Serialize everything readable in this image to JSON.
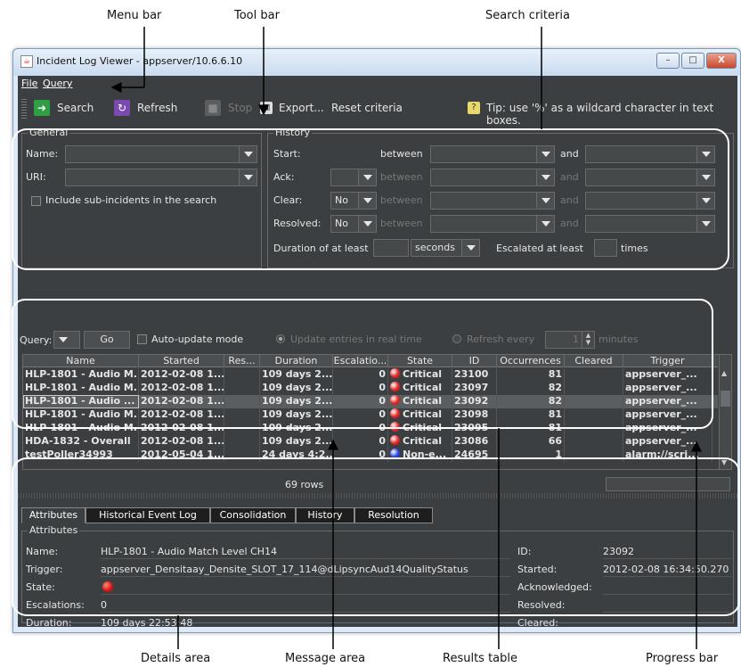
{
  "callouts": {
    "menu_bar": "Menu bar",
    "tool_bar": "Tool bar",
    "search_criteria": "Search criteria",
    "details_area": "Details area",
    "message_area": "Message area",
    "results_table": "Results table",
    "progress_bar": "Progress bar"
  },
  "window": {
    "title": "Incident Log Viewer - appserver/10.6.6.10",
    "minimize": "–",
    "maximize": "□",
    "close": "X"
  },
  "menu": {
    "file": "File",
    "query": "Query"
  },
  "toolbar": {
    "search": "Search",
    "refresh": "Refresh",
    "stop": "Stop",
    "export": "Export...",
    "reset": "Reset criteria",
    "tip": "Tip: use '%' as a wildcard character in text boxes."
  },
  "general": {
    "title": "General",
    "name_label": "Name:",
    "uri_label": "URI:",
    "include_sub": "Include sub-incidents in the search"
  },
  "history": {
    "title": "History",
    "start_label": "Start:",
    "ack_label": "Ack:",
    "clear_label": "Clear:",
    "resolved_label": "Resolved:",
    "between": "between",
    "and": "and",
    "clear_value": "No",
    "resolved_value": "No",
    "duration_label": "Duration of at least",
    "duration_unit": "seconds",
    "escalated_label": "Escalated at least",
    "times": "times"
  },
  "querybar": {
    "query_label": "Query:",
    "go": "Go",
    "auto_update": "Auto-update mode",
    "realtime": "Update entries in real time",
    "refresh_every": "Refresh every",
    "refresh_value": "1",
    "minutes": "minutes"
  },
  "table": {
    "headers": [
      "Name",
      "Started",
      "Res...",
      "Duration",
      "Escalatio...",
      "State",
      "ID",
      "Occurrences",
      "Cleared",
      "Trigger"
    ],
    "rows": [
      {
        "name": "HLP-1801 - Audio M...",
        "started": "2012-02-08 1...",
        "res": "",
        "duration": "109 days 2...",
        "esc": "0",
        "state": "Critical",
        "state_color": "#e02020",
        "id": "23100",
        "occ": "81",
        "cleared": "",
        "trigger": "appserver_..."
      },
      {
        "name": "HLP-1801 - Audio M...",
        "started": "2012-02-08 1...",
        "res": "",
        "duration": "109 days 2...",
        "esc": "0",
        "state": "Critical",
        "state_color": "#e02020",
        "id": "23097",
        "occ": "82",
        "cleared": "",
        "trigger": "appserver_..."
      },
      {
        "name": "HLP-1801 - Audio ...",
        "started": "2012-02-08 1...",
        "res": "",
        "duration": "109 days 2...",
        "esc": "0",
        "state": "Critical",
        "state_color": "#e02020",
        "id": "23092",
        "occ": "82",
        "cleared": "",
        "trigger": "appserver_..."
      },
      {
        "name": "HLP-1801 - Audio M...",
        "started": "2012-02-08 1...",
        "res": "",
        "duration": "109 days 2...",
        "esc": "0",
        "state": "Critical",
        "state_color": "#e02020",
        "id": "23098",
        "occ": "81",
        "cleared": "",
        "trigger": "appserver_..."
      },
      {
        "name": "HLP-1801 - Audio M...",
        "started": "2012-02-08 1...",
        "res": "",
        "duration": "109 days 2...",
        "esc": "0",
        "state": "Critical",
        "state_color": "#e02020",
        "id": "23095",
        "occ": "81",
        "cleared": "",
        "trigger": "appserver_..."
      },
      {
        "name": "HDA-1832 - Overall",
        "started": "2012-02-08 1...",
        "res": "",
        "duration": "109 days 2...",
        "esc": "0",
        "state": "Critical",
        "state_color": "#e02020",
        "id": "23086",
        "occ": "66",
        "cleared": "",
        "trigger": "appserver_..."
      },
      {
        "name": "testPoller34993",
        "started": "2012-05-04 1...",
        "res": "",
        "duration": "24 days 4:2...",
        "esc": "0",
        "state": "Non-e...",
        "state_color": "#2040e0",
        "id": "24695",
        "occ": "1",
        "cleared": "",
        "trigger": "alarm://scri..."
      }
    ]
  },
  "status": {
    "rows": "69 rows"
  },
  "details": {
    "tabs": [
      "Attributes",
      "Historical Event Log",
      "Consolidation",
      "History",
      "Resolution"
    ],
    "section": "Attributes",
    "name_label": "Name:",
    "name_value": "HLP-1801 - Audio Match Level CH14",
    "trigger_label": "Trigger:",
    "trigger_value": "appserver_Densitaay_Densite_SLOT_17_114@dLipsyncAud14QualityStatus",
    "state_label": "State:",
    "escalations_label": "Escalations:",
    "escalations_value": "0",
    "duration_label": "Duration:",
    "duration_value": "109 days 22:53:48",
    "id_label": "ID:",
    "id_value": "23092",
    "started_label": "Started:",
    "started_value": "2012-02-08 16:34:50.270",
    "ack_label": "Acknowledged:",
    "resolved_label": "Resolved:",
    "cleared_label": "Cleared:"
  }
}
